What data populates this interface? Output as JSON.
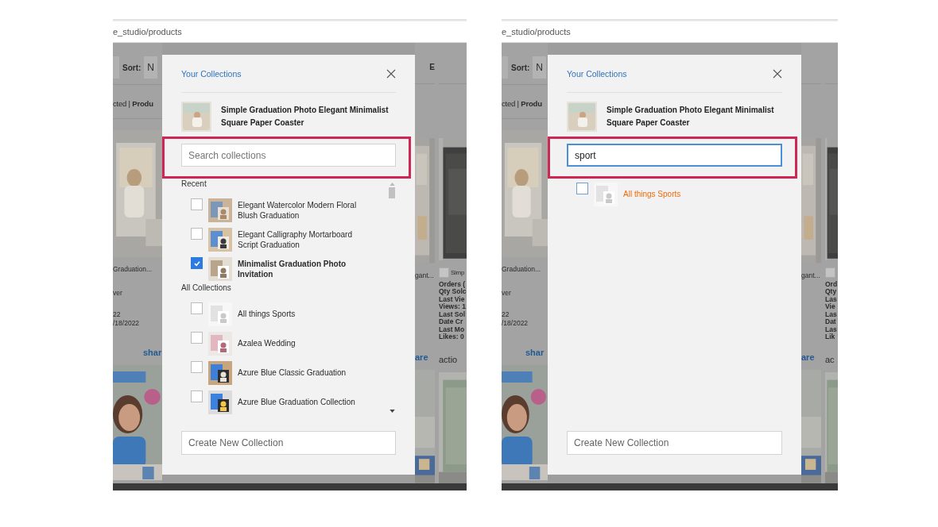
{
  "panels": [
    {
      "address": "e_studio/products",
      "page": {
        "sort_label": "Sort:",
        "sort_value": "N",
        "corner_label": "E",
        "selection_text": "cted | **Produ**",
        "left": {
          "card_title": "Graduation...",
          "lines": [
            "ver",
            "22",
            "/18/2022"
          ],
          "share_link": "shar"
        },
        "right_a": {
          "card_title": "gant...",
          "share_link": "are"
        },
        "right_b": {
          "checked": false,
          "card_title": "Simp",
          "lines": [
            "Orders (",
            "Qty Solc",
            "Last Vie",
            "Views: 1",
            "Last Sol",
            "Date Cr",
            "Last Mo",
            "Likes: 0"
          ],
          "action": "actio"
        }
      },
      "dialog": {
        "title": "Your Collections",
        "product": "Simple Graduation Photo Elegant Minimalist Square Paper Coaster",
        "search": {
          "placeholder": "Search collections",
          "focused": false
        },
        "search_outlined": true,
        "scrollable": true,
        "sections": [
          {
            "heading": "Recent",
            "items": [
              {
                "name": "Elegant Watercolor Modern Floral Blush Graduation",
                "checked": false,
                "matched": false
              },
              {
                "name": "Elegant Calligraphy Mortarboard Script Graduation",
                "checked": false,
                "matched": false
              },
              {
                "name": "Minimalist Graduation Photo Invitation",
                "checked": true,
                "matched": false
              }
            ]
          },
          {
            "heading": "All Collections",
            "items": [
              {
                "name": "All things Sports",
                "checked": false,
                "matched": false
              },
              {
                "name": "Azalea Wedding",
                "checked": false,
                "matched": false
              },
              {
                "name": "Azure Blue Classic Graduation",
                "checked": false,
                "matched": false
              },
              {
                "name": "Azure Blue Graduation Collection",
                "checked": false,
                "matched": false
              }
            ]
          }
        ],
        "create_placeholder": "Create New Collection"
      }
    },
    {
      "address": "e_studio/products",
      "page": {
        "sort_label": "Sort:",
        "sort_value": "N",
        "selection_text": "cted | **Produ**",
        "left": {
          "card_title": "Graduation...",
          "lines": [
            "ver",
            "22",
            "/18/2022"
          ],
          "share_link": "shar"
        },
        "right_a": {
          "card_title": "gant...",
          "share_link": "are"
        },
        "right_b": {
          "checked": false,
          "lines": [
            "Ord",
            "Qty",
            "Las",
            "Vie",
            "Las",
            "Dat",
            "Las",
            "Lik"
          ],
          "action": "ac"
        }
      },
      "dialog": {
        "title": "Your Collections",
        "product": "Simple Graduation Photo Elegant Minimalist Square Paper Coaster",
        "search": {
          "value": "sport",
          "focused": true
        },
        "search_outlined": true,
        "scrollable": false,
        "sections": [
          {
            "items": [
              {
                "name": "All things Sports",
                "checked": false,
                "matched": true
              }
            ]
          }
        ],
        "create_placeholder": "Create New Collection"
      }
    }
  ]
}
